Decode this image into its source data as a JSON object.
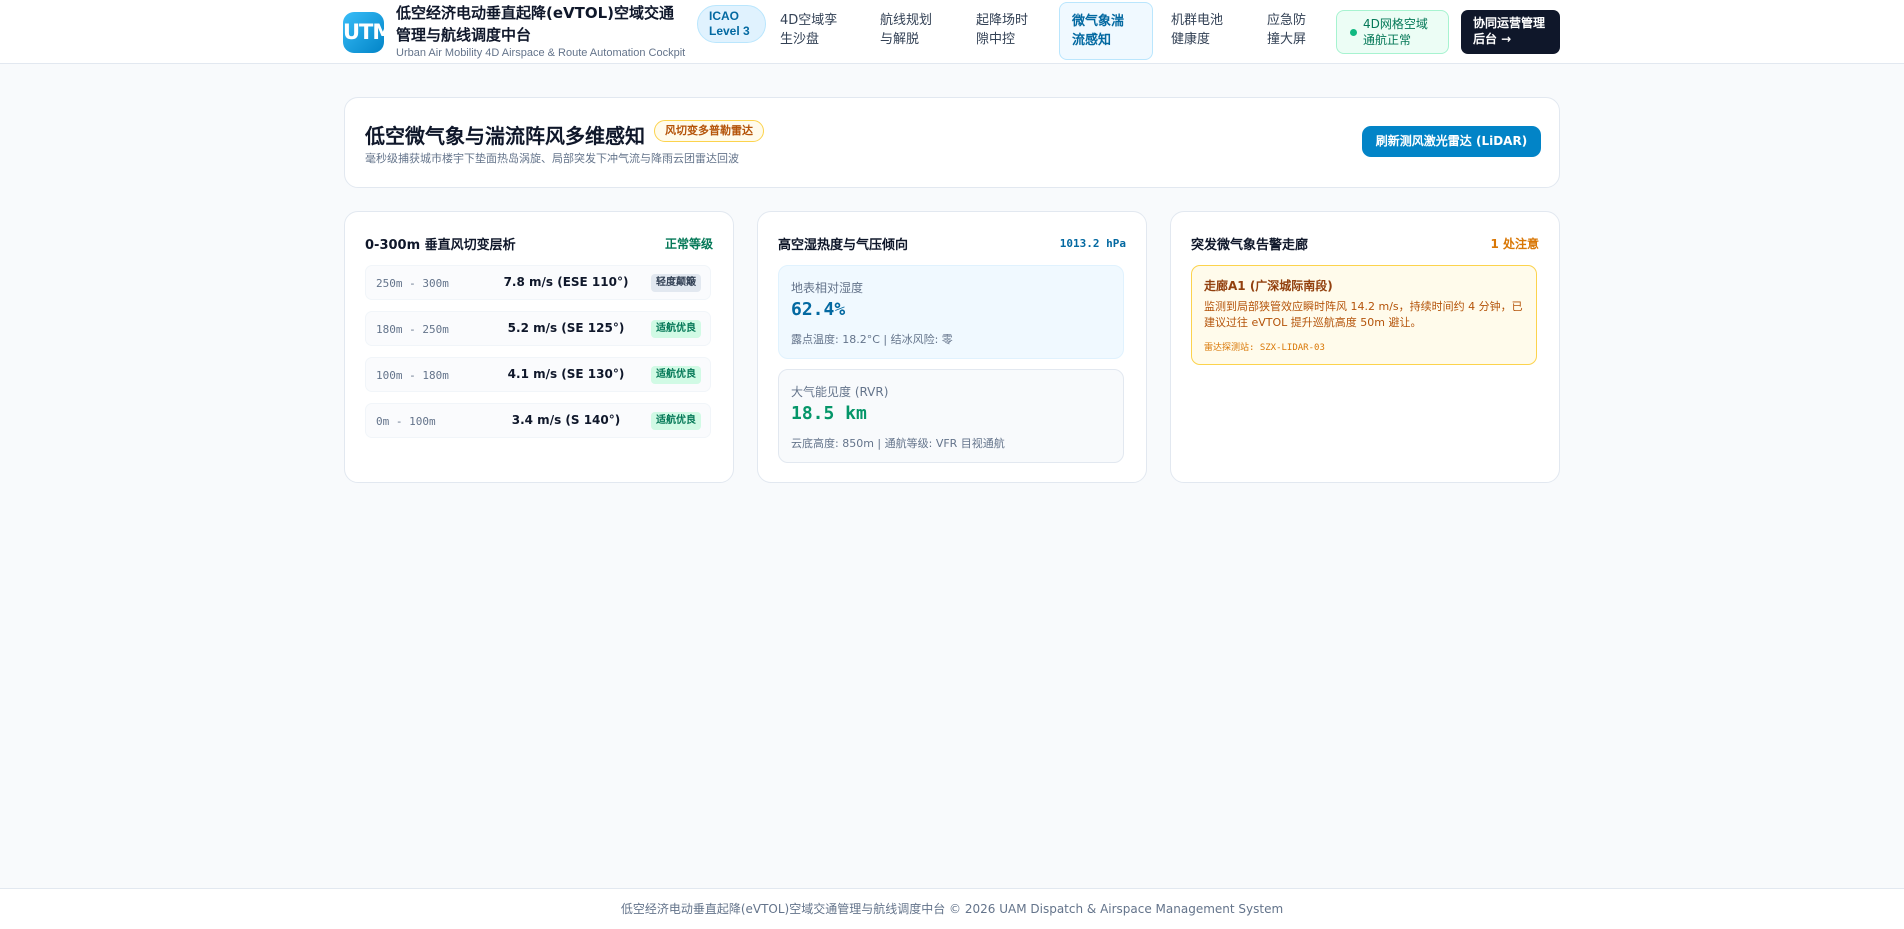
{
  "header": {
    "logo_text": "UTM",
    "title": "低空经济电动垂直起降(eVTOL)空域交通管理与航线调度中台",
    "subtitle": "Urban Air Mobility 4D Airspace & Route Automation Cockpit",
    "icao_line1": "ICAO",
    "icao_line2": "Level 3",
    "nav": [
      {
        "line1": "4D空域孪",
        "line2": "生沙盘"
      },
      {
        "line1": "航线规划",
        "line2": "与解脱"
      },
      {
        "line1": "起降场时",
        "line2": "隙中控"
      },
      {
        "line1": "微气象湍",
        "line2": "流感知"
      },
      {
        "line1": "机群电池",
        "line2": "健康度"
      },
      {
        "line1": "应急防",
        "line2": "撞大屏"
      }
    ],
    "status_line1": "4D网格空域",
    "status_line2": "通航正常",
    "admin_line1": "协同运营管理",
    "admin_line2": "后台 →"
  },
  "banner": {
    "title": "低空微气象与湍流阵风多维感知",
    "badge": "风切变多普勒雷达",
    "subtitle": "毫秒级捕获城市楼宇下垫面热岛涡旋、局部突发下冲气流与降雨云团雷达回波",
    "refresh_label": "刷新测风激光雷达 (LiDAR)"
  },
  "wind_shear": {
    "title": "0-300m 垂直风切变层析",
    "level": "正常等级",
    "rows": [
      {
        "altitude": "250m - 300m",
        "value": "7.8 m/s (ESE 110°)",
        "badge": "轻度颠簸"
      },
      {
        "altitude": "180m - 250m",
        "value": "5.2 m/s (SE 125°)",
        "badge": "适航优良"
      },
      {
        "altitude": "100m - 180m",
        "value": "4.1 m/s (SE 130°)",
        "badge": "适航优良"
      },
      {
        "altitude": "0m - 100m",
        "value": "3.4 m/s (S 140°)",
        "badge": "适航优良"
      }
    ]
  },
  "humidity": {
    "title": "高空湿热度与气压倾向",
    "pressure": "1013.2 hPa",
    "rh_label": "地表相对湿度",
    "rh_value": "62.4%",
    "rh_note": "露点温度: 18.2°C | 结冰风险: 零",
    "rvr_label": "大气能见度 (RVR)",
    "rvr_value": "18.5 km",
    "rvr_note": "云底高度: 850m | 通航等级: VFR 目视通航"
  },
  "alerts": {
    "title": "突发微气象告警走廊",
    "count": "1 处注意",
    "item_title": "走廊A1 (广深城际南段)",
    "item_body": "监测到局部狭管效应瞬时阵风 14.2 m/s，持续时间约 4 分钟，已建议过往 eVTOL 提升巡航高度 50m 避让。",
    "item_source": "雷达探测站: SZX-LIDAR-03"
  },
  "colors": {
    "accent": "#0284c7",
    "ok": "#047857",
    "warn": "#d97706",
    "rh_value": "#0369a1",
    "rvr_value": "#059669"
  },
  "footer": "低空经济电动垂直起降(eVTOL)空域交通管理与航线调度中台 © 2026 UAM Dispatch & Airspace Management System"
}
